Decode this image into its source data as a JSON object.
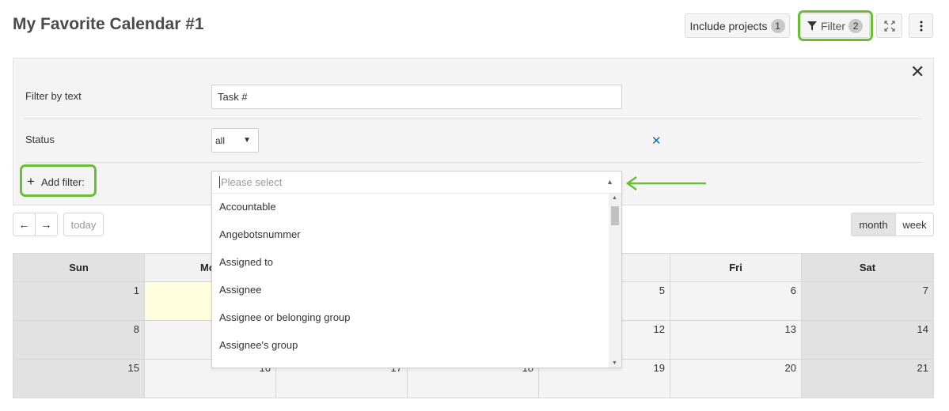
{
  "page": {
    "title": "My Favorite Calendar #1"
  },
  "toolbar": {
    "include_projects_label": "Include projects",
    "include_projects_count": "1",
    "filter_label": "Filter",
    "filter_count": "2",
    "fullscreen_icon": "expand-icon",
    "more_icon": "kebab-icon"
  },
  "filters": {
    "text_label": "Filter by text",
    "text_value": "Task #",
    "status_label": "Status",
    "status_value": "all",
    "add_filter_label": "Add filter:",
    "select_placeholder": "Please select",
    "options": [
      "Accountable",
      "Angebotsnummer",
      "Assigned to",
      "Assignee",
      "Assignee or belonging group",
      "Assignee's group"
    ]
  },
  "nav": {
    "prev_icon": "arrow-left-icon",
    "next_icon": "arrow-right-icon",
    "today_label": "today"
  },
  "views": {
    "month_label": "month",
    "week_label": "week",
    "active": "month"
  },
  "calendar": {
    "days": [
      "Sun",
      "Mo",
      "",
      "",
      "",
      "Fri",
      "Sat"
    ],
    "weeks": [
      [
        "1",
        "",
        "",
        "",
        "5",
        "6",
        "7"
      ],
      [
        "8",
        "",
        "",
        "",
        "12",
        "13",
        "14"
      ],
      [
        "15",
        "16",
        "17",
        "18",
        "19",
        "20",
        "21"
      ]
    ]
  },
  "colors": {
    "highlight": "#6bbd35",
    "link": "#1a67a3",
    "today_cell": "#ffffe0"
  }
}
